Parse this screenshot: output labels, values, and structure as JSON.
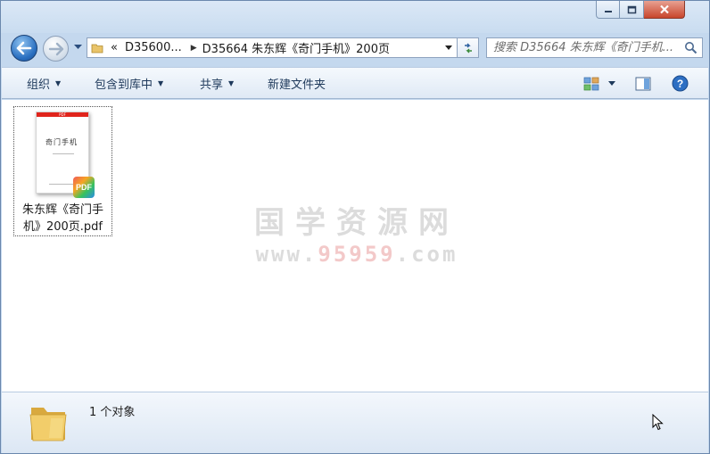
{
  "window": {
    "controls": {
      "minimize": "minimize",
      "maximize": "maximize",
      "close": "close"
    }
  },
  "nav": {
    "breadcrumb": {
      "overflow": "«",
      "parent": "D35600...",
      "current": "D35664 朱东辉《奇门手机》200页"
    },
    "search_placeholder": "搜索 D35664 朱东辉《奇门手机...",
    "icons": {
      "back": "back-arrow-icon",
      "forward": "forward-arrow-icon",
      "refresh": "refresh-icon",
      "search": "search-icon"
    }
  },
  "toolbar": {
    "organize": "组织",
    "include_in_library": "包含到库中",
    "share": "共享",
    "new_folder": "新建文件夹"
  },
  "files": [
    {
      "name": "朱东辉《奇门手机》200页.pdf",
      "thumbnail_title": "奇门手机",
      "thumbnail_header": "PDF",
      "badge": "PDF",
      "selected": true
    }
  ],
  "watermark": {
    "main": "国学资源网",
    "url_prefix": "www.",
    "url_highlight": "95959",
    "url_suffix": ".com"
  },
  "status": {
    "count_text": "1 个对象"
  },
  "colors": {
    "accent": "#2a6fc0",
    "toolbar_text": "#1e395b",
    "watermark": "#dcdcdc",
    "watermark_highlight": "#f3c9c9"
  }
}
